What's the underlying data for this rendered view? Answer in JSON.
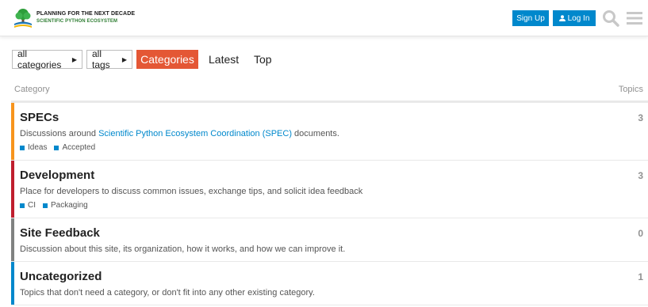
{
  "header": {
    "brand_line1": "PLANNING FOR THE NEXT DECADE",
    "brand_line2": "SCIENTIFIC PYTHON ECOSYSTEM",
    "signup_label": "Sign Up",
    "login_label": "Log In",
    "accent": "#0088cc"
  },
  "nav": {
    "category_filter": "all categories",
    "tag_filter": "all tags",
    "tabs": [
      "Categories",
      "Latest",
      "Top"
    ],
    "active_tab_color": "#e45735"
  },
  "table": {
    "col_category": "Category",
    "col_topics": "Topics"
  },
  "categories": [
    {
      "name": "SPECs",
      "desc_prefix": "Discussions around ",
      "desc_link": "Scientific Python Ecosystem Coordination (SPEC)",
      "desc_suffix": " documents.",
      "topics": "3",
      "color": "#f7941d",
      "subcategories": [
        "Ideas",
        "Accepted"
      ]
    },
    {
      "name": "Development",
      "description": "Place for developers to discuss common issues, exchange tips, and solicit idea feedback",
      "topics": "3",
      "color": "#bf1e2e",
      "subcategories": [
        "CI",
        "Packaging"
      ]
    },
    {
      "name": "Site Feedback",
      "description": "Discussion about this site, its organization, how it works, and how we can improve it.",
      "topics": "0",
      "color": "#808281"
    },
    {
      "name": "Uncategorized",
      "description": "Topics that don't need a category, or don't fit into any other existing category.",
      "topics": "1",
      "color": "#0088cc"
    }
  ]
}
